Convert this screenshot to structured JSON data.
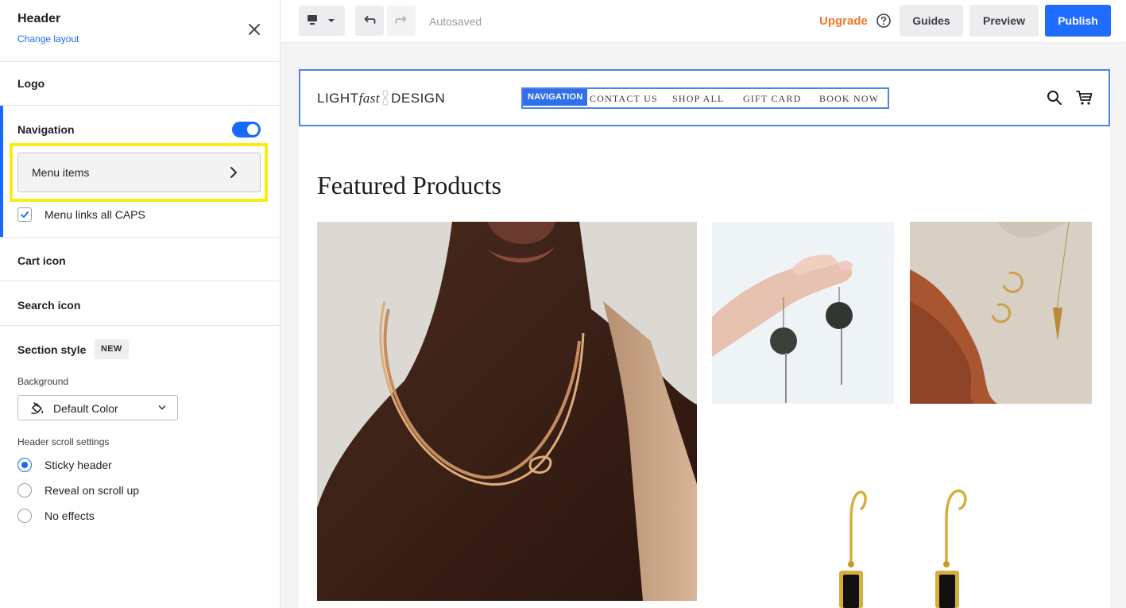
{
  "panel": {
    "title": "Header",
    "change_layout": "Change layout",
    "sections": {
      "logo": "Logo",
      "navigation": "Navigation",
      "cart_icon": "Cart icon",
      "search_icon": "Search icon",
      "section_style": "Section style"
    },
    "navigation_enabled": true,
    "menu_items_label": "Menu items",
    "caps_label": "Menu links all CAPS",
    "caps_checked": true,
    "new_badge": "NEW",
    "background_label": "Background",
    "background_value": "Default Color",
    "scroll_settings_label": "Header scroll settings",
    "scroll_options": [
      "Sticky header",
      "Reveal on scroll up",
      "No effects"
    ],
    "scroll_selected": "Sticky header"
  },
  "toolbar": {
    "autosaved": "Autosaved",
    "upgrade": "Upgrade",
    "guides": "Guides",
    "preview": "Preview",
    "publish": "Publish"
  },
  "site": {
    "logo_part1": "LIGHT",
    "logo_part2": "fast",
    "logo_part3": "DESIGN",
    "nav_tag": "NAVIGATION",
    "nav_links": [
      "CONTACT US",
      "SHOP ALL",
      "GIFT CARD",
      "BOOK NOW"
    ],
    "featured_title": "Featured Products"
  },
  "colors": {
    "accent": "#1769ff",
    "publish": "#1f6cff",
    "upgrade": "#f5762b",
    "highlight": "#f7ec19",
    "selection_border": "#4f83e8"
  },
  "icons": [
    "close-icon",
    "chevron-right-icon",
    "check-icon",
    "paint-bucket-icon",
    "chevron-down-icon",
    "desktop-icon",
    "undo-icon",
    "redo-icon",
    "help-icon",
    "search-icon",
    "cart-icon"
  ]
}
